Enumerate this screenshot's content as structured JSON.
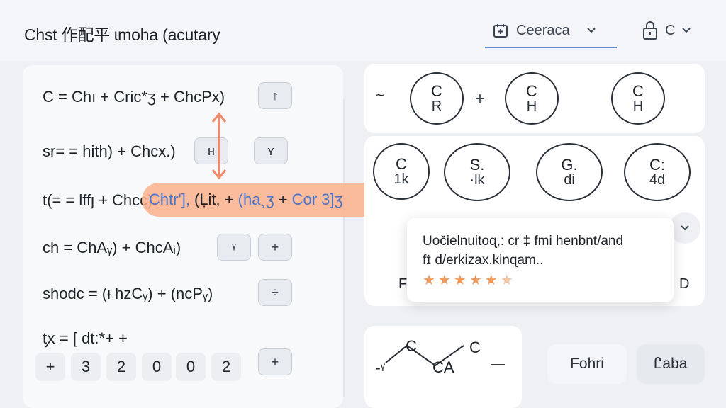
{
  "header": {
    "title": "Chst 作配平 ɩmoha (acutary",
    "calendar_tab_label": "Ceeraca",
    "lock_menu_label": "C"
  },
  "equations": [
    {
      "text": "C = Chı + Cric*ʒ + ChcPx)",
      "button": "↑"
    },
    {
      "text": "sr= = hith) + Chcx.)",
      "button": "н",
      "button2": "ʏ"
    },
    {
      "text": "t(= = lffȷ + Chcc) +",
      "button": ""
    },
    {
      "text": "ch = ChAᵧ) + ChcAᵢ)",
      "button": "ᵞ",
      "button2": "+"
    },
    {
      "text": "shodc = (ᵻ hzCᵧ) + (ncPᵧ)",
      "button": "÷"
    },
    {
      "text": "tꭗ = [ dt:*+ +",
      "button": "+"
    }
  ],
  "digits": [
    "+",
    "3",
    "2",
    "0",
    "0",
    "2"
  ],
  "highlight": {
    "a": "t(= = lffȷ + Chcc) +",
    "b": "Chtr'],",
    "c": "(Ḷit, +",
    "d": "(ha¸ʒ",
    "e": "+",
    "f": "Cor 3]ʒ"
  },
  "structures": {
    "top_left_mark": "~",
    "top": [
      {
        "top": "C",
        "bottom": "R"
      },
      {
        "top": "C",
        "bottom": "H"
      },
      {
        "top": "C",
        "bottom": "H"
      }
    ],
    "plus": "+",
    "grid": [
      {
        "top": "C",
        "bottom": "1k"
      },
      {
        "top": "S.",
        "bottom": "·lk"
      },
      {
        "top": "G.",
        "bottom": "di"
      },
      {
        "top": "C:",
        "bottom": "4d"
      }
    ],
    "left_corner": "F",
    "right_corner": "D"
  },
  "tooltip": {
    "line1": "Uočielnuitoɋ,: cr ‡ fmi henbnt/and",
    "line2": "fɪ̇ d/erkizax.kinɋam..",
    "rating": 5.5
  },
  "bottom": {
    "molecule_labels": [
      "C",
      "CA",
      "C"
    ],
    "left_tick": "-ᵞ",
    "right_dash": "—",
    "button1": "Fohri",
    "button2": "Ꮭaba"
  },
  "colors": {
    "accent": "#5d8fd9",
    "highlight": "#fab28c",
    "star": "#ef9a5a"
  }
}
